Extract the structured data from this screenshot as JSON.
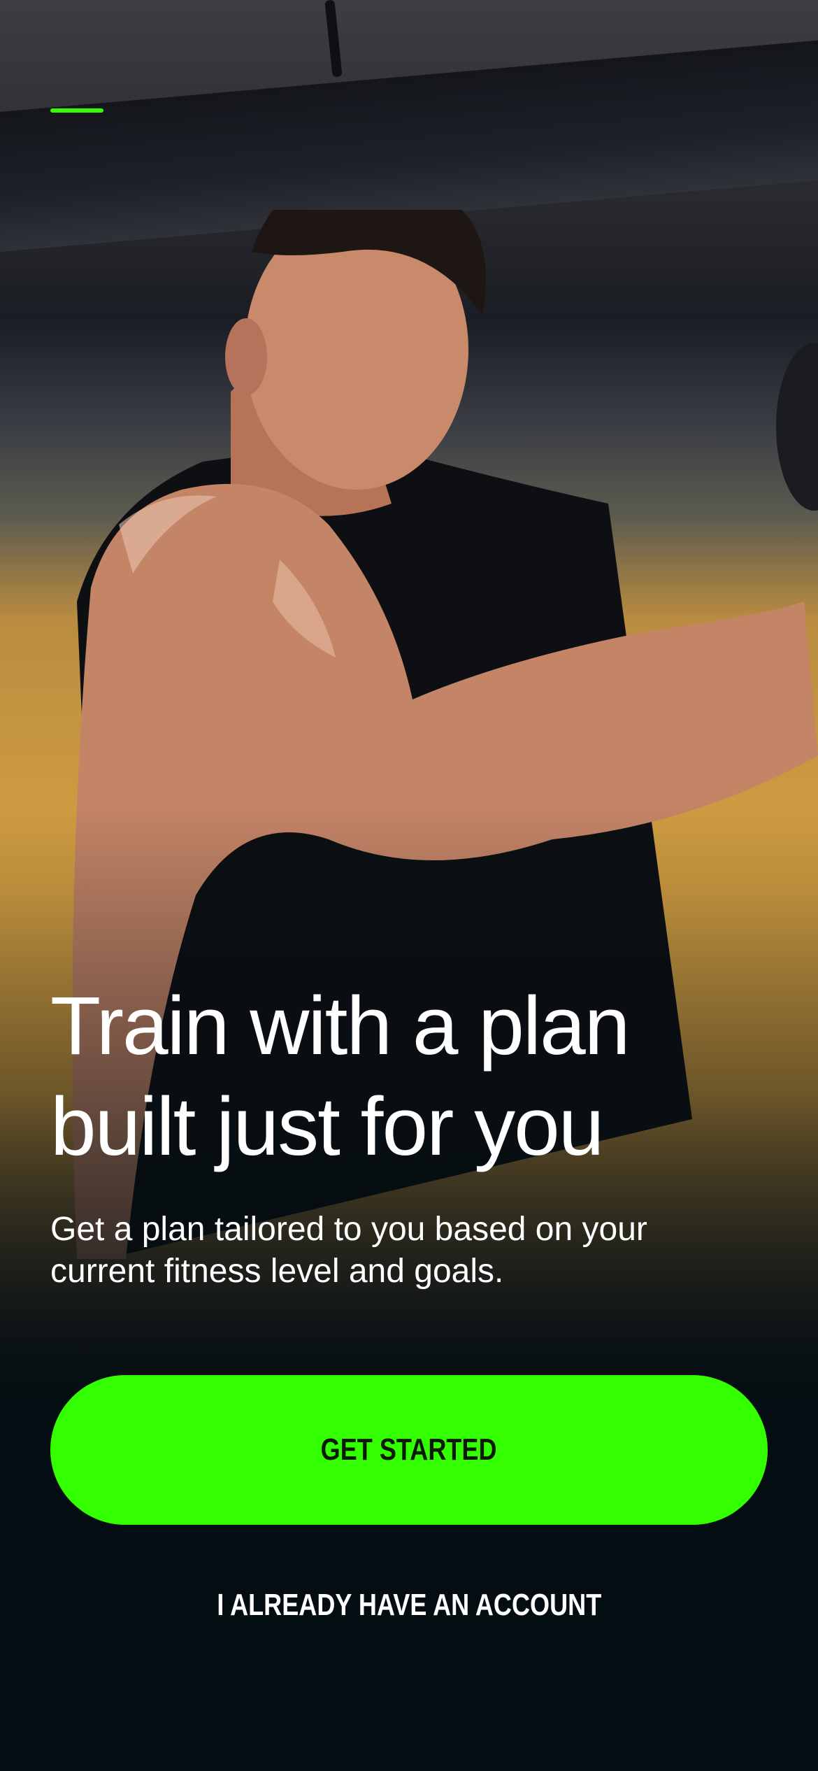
{
  "onboarding": {
    "headline_line1": "Train with a plan",
    "headline_line2": "built just for you",
    "subtitle_line1": "Get a plan tailored to you based on your",
    "subtitle_line2": "current fitness level and goals.",
    "get_started_label": "GET STARTED",
    "login_label": "I ALREADY HAVE AN ACCOUNT",
    "hero_image": "man-flexing-bicep-in-gym",
    "progress_icon": "page-indicator-dash"
  },
  "colors": {
    "accent": "#34ff00",
    "background": "#030d12",
    "text": "#ffffff",
    "cta_text": "#0c1a0a"
  }
}
